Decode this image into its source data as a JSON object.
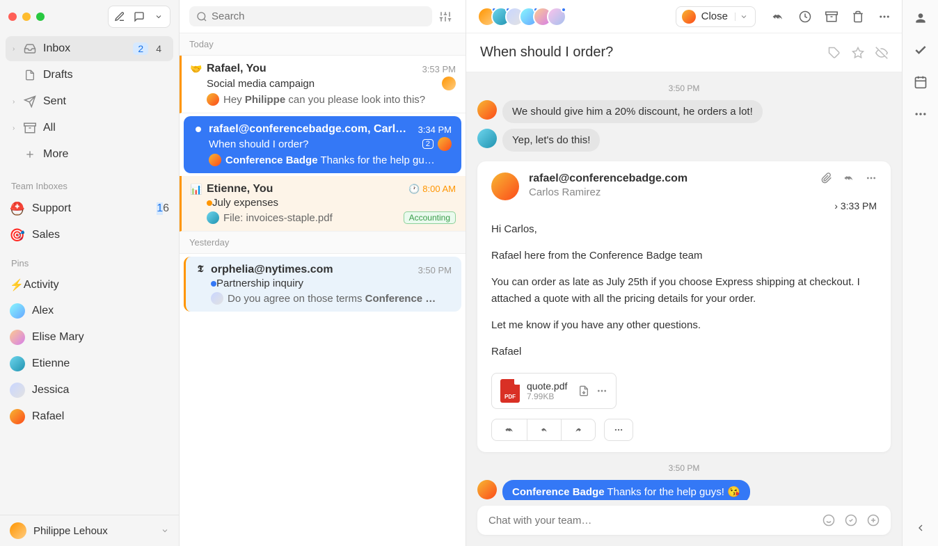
{
  "sidebar": {
    "nav": [
      {
        "label": "Inbox",
        "badge_primary": "2",
        "badge_secondary": "4",
        "active": true
      },
      {
        "label": "Drafts"
      },
      {
        "label": "Sent"
      },
      {
        "label": "All"
      },
      {
        "label": "More"
      }
    ],
    "team_title": "Team Inboxes",
    "team": [
      {
        "label": "Support",
        "badge_primary": "1",
        "badge_secondary": "6"
      },
      {
        "label": "Sales"
      }
    ],
    "pins_title": "Pins",
    "pins": [
      {
        "label": "Activity"
      },
      {
        "label": "Alex"
      },
      {
        "label": "Elise Mary"
      },
      {
        "label": "Etienne"
      },
      {
        "label": "Jessica"
      },
      {
        "label": "Rafael"
      }
    ],
    "user": "Philippe Lehoux"
  },
  "search": {
    "placeholder": "Search"
  },
  "list": {
    "day1": "Today",
    "day2": "Yesterday",
    "threads": [
      {
        "from": "Rafael, You",
        "time": "3:53 PM",
        "subject": "Social media campaign",
        "preview_prefix": "Hey ",
        "preview_bold": "Philippe",
        "preview_suffix": " can you please look into this?"
      },
      {
        "from": "rafael@conferencebadge.com, Carl…",
        "time": "3:34 PM",
        "subject": "When should I order?",
        "count": "2",
        "preview_bold": "Conference Badge",
        "preview_suffix": " Thanks for the help gu…"
      },
      {
        "from": "Etienne, You",
        "time": "8:00 AM",
        "subject": "July expenses",
        "preview": "File: invoices-staple.pdf",
        "tag": "Accounting"
      },
      {
        "from": "orphelia@nytimes.com",
        "time": "3:50 PM",
        "subject": "Partnership inquiry",
        "preview_prefix": "Do you agree on those terms ",
        "preview_bold": "Conference …"
      }
    ]
  },
  "detail": {
    "close_label": "Close",
    "subject": "When should I order?",
    "ts1": "3:50 PM",
    "chat1": "We should give him a 20% discount, he orders a lot!",
    "chat2": "Yep, let's do this!",
    "email": {
      "from": "rafael@conferencebadge.com",
      "to": "Carlos Ramirez",
      "time": "3:33 PM",
      "p1": "Hi Carlos,",
      "p2": "Rafael here from the Conference Badge team",
      "p3": "You can order as late as July 25th if you choose Express shipping at checkout. I attached a quote with all the pricing details for your order.",
      "p4": "Let me know if you have any other questions.",
      "p5": "Rafael",
      "attachment_name": "quote.pdf",
      "attachment_size": "7.99KB"
    },
    "ts2": "3:50 PM",
    "chat3_bold": "Conference Badge",
    "chat3_rest": " Thanks for the help guys! ",
    "compose_placeholder": "Chat with your team…"
  }
}
